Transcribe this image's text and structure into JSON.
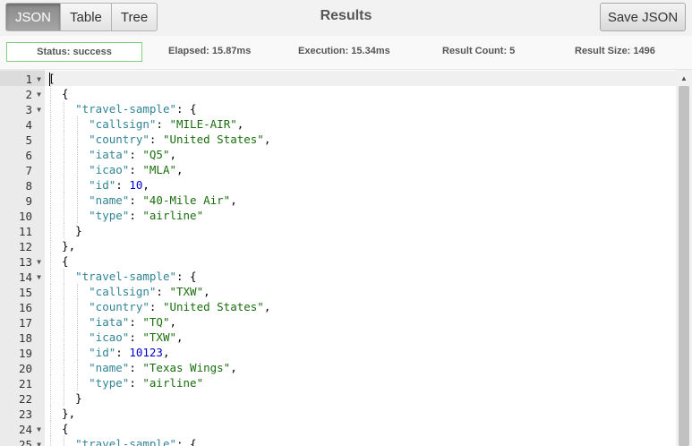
{
  "toolbar": {
    "views": [
      "JSON",
      "Table",
      "Tree"
    ],
    "active_view": "JSON",
    "title": "Results",
    "save_label": "Save JSON"
  },
  "status": {
    "status": "Status: success",
    "elapsed": "Elapsed: 15.87ms",
    "execution": "Execution: 15.34ms",
    "result_count": "Result Count: 5",
    "result_size": "Result Size: 1496"
  },
  "colors": {
    "key": "#318495",
    "string": "#1a6e0e",
    "number": "#0000cd",
    "status_border": "#7fcf7f"
  },
  "editor": {
    "active_line": 1,
    "lines": [
      {
        "n": "1",
        "fold": true,
        "text": "["
      },
      {
        "n": "2",
        "fold": true,
        "text": "  {"
      },
      {
        "n": "3",
        "fold": true,
        "text": "    \"travel-sample\": {"
      },
      {
        "n": "4",
        "fold": false,
        "text": "      \"callsign\": \"MILE-AIR\","
      },
      {
        "n": "5",
        "fold": false,
        "text": "      \"country\": \"United States\","
      },
      {
        "n": "6",
        "fold": false,
        "text": "      \"iata\": \"Q5\","
      },
      {
        "n": "7",
        "fold": false,
        "text": "      \"icao\": \"MLA\","
      },
      {
        "n": "8",
        "fold": false,
        "text": "      \"id\": 10,"
      },
      {
        "n": "9",
        "fold": false,
        "text": "      \"name\": \"40-Mile Air\","
      },
      {
        "n": "10",
        "fold": false,
        "text": "      \"type\": \"airline\""
      },
      {
        "n": "11",
        "fold": false,
        "text": "    }"
      },
      {
        "n": "12",
        "fold": false,
        "text": "  },"
      },
      {
        "n": "13",
        "fold": true,
        "text": "  {"
      },
      {
        "n": "14",
        "fold": true,
        "text": "    \"travel-sample\": {"
      },
      {
        "n": "15",
        "fold": false,
        "text": "      \"callsign\": \"TXW\","
      },
      {
        "n": "16",
        "fold": false,
        "text": "      \"country\": \"United States\","
      },
      {
        "n": "17",
        "fold": false,
        "text": "      \"iata\": \"TQ\","
      },
      {
        "n": "18",
        "fold": false,
        "text": "      \"icao\": \"TXW\","
      },
      {
        "n": "19",
        "fold": false,
        "text": "      \"id\": 10123,"
      },
      {
        "n": "20",
        "fold": false,
        "text": "      \"name\": \"Texas Wings\","
      },
      {
        "n": "21",
        "fold": false,
        "text": "      \"type\": \"airline\""
      },
      {
        "n": "22",
        "fold": false,
        "text": "    }"
      },
      {
        "n": "23",
        "fold": false,
        "text": "  },"
      },
      {
        "n": "24",
        "fold": true,
        "text": "  {"
      },
      {
        "n": "25",
        "fold": true,
        "text": "    \"travel-sample\": {"
      }
    ]
  }
}
